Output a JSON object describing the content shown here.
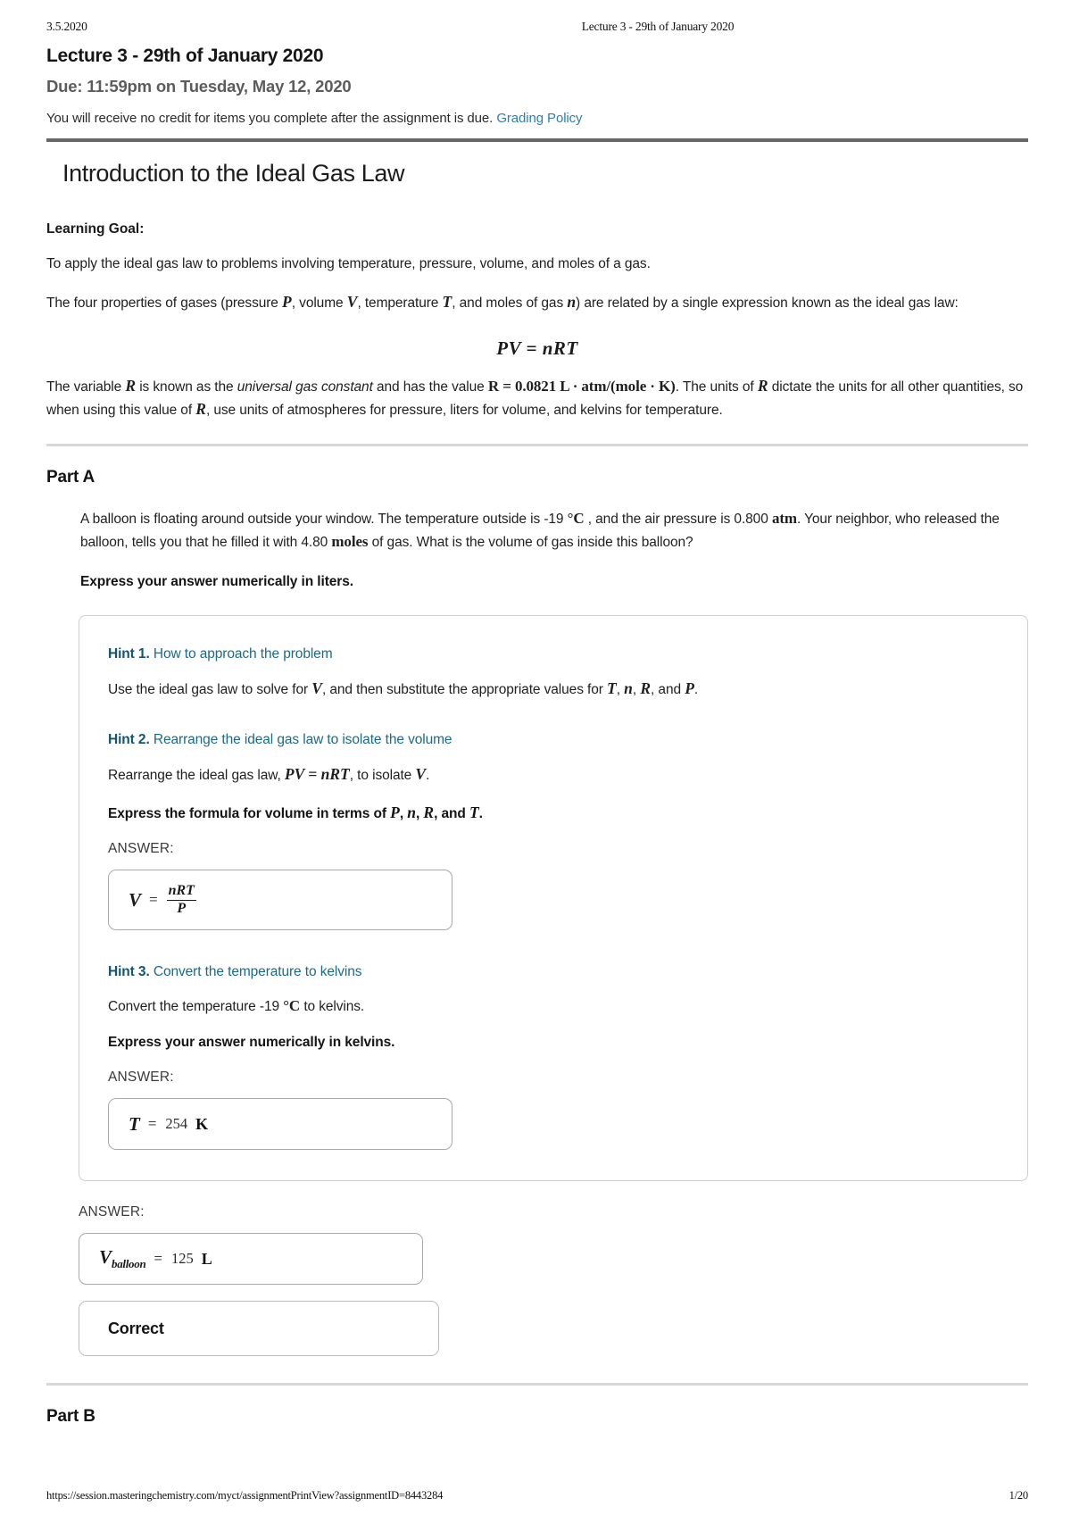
{
  "running_header": {
    "date": "3.5.2020",
    "title": "Lecture 3 - 29th of January 2020"
  },
  "assignment": {
    "title": "Lecture 3 - 29th of January 2020",
    "due": "Due: 11:59pm on Tuesday, May 12, 2020",
    "credit_note": "You will receive no credit for items you complete after the assignment is due.",
    "grading_policy_link": "Grading Policy"
  },
  "item": {
    "title": "Introduction to the Ideal Gas Law",
    "learning_goal_label": "Learning Goal:",
    "learning_goal_text": "To apply the ideal gas law to problems involving temperature, pressure, volume, and moles of a gas.",
    "intro_part1": "The four properties of gases (pressure ",
    "intro_var_P": "P",
    "intro_part2": ", volume ",
    "intro_var_V": "V",
    "intro_part3": ", temperature ",
    "intro_var_T": "T",
    "intro_part4": ", and moles of gas ",
    "intro_var_n": "n",
    "intro_part5": ") are related by a single expression known as the ideal gas law:",
    "display_equation": "PV = nRT",
    "constant_part1": "The variable ",
    "constant_var_R": "R",
    "constant_part2": " is known as the ",
    "constant_italic": "universal gas constant",
    "constant_part3": " and has the value ",
    "constant_value": "R = 0.0821 L · atm/(mole · K)",
    "constant_part4": ". The units of ",
    "constant_var_R2": "R",
    "constant_part5": " dictate the units for all other quantities, so when using this value of ",
    "constant_var_R3": "R",
    "constant_part6": ", use units of atmospheres for pressure, liters for volume, and kelvins for temperature."
  },
  "part_a": {
    "heading": "Part A",
    "question_p1": "A balloon is floating around outside your window. The temperature outside is -19 ",
    "question_unit_c": "°C",
    "question_p2": " , and the air pressure is 0.800 ",
    "question_unit_atm": "atm",
    "question_p3": ". Your neighbor, who released the balloon, tells you that he filled it with 4.80 ",
    "question_unit_moles": "moles",
    "question_p4": " of gas. What is the volume of gas inside this balloon?",
    "instruction": "Express your answer numerically in liters.",
    "answer_label": "ANSWER:",
    "answer_var": "V",
    "answer_sub": "balloon",
    "answer_eq": "=",
    "answer_value": "125",
    "answer_unit": "L",
    "feedback": "Correct"
  },
  "hints": [
    {
      "number": "Hint 1.",
      "title": " How to approach the problem",
      "body_p1": "Use the ideal gas law to solve for ",
      "body_v": "V",
      "body_p2": ", and then substitute the appropriate values for ",
      "body_T": "T",
      "body_sep1": ", ",
      "body_n": "n",
      "body_sep2": ", ",
      "body_R": "R",
      "body_sep3": ", and ",
      "body_P": "P",
      "body_p3": "."
    },
    {
      "number": "Hint 2.",
      "title": " Rearrange the ideal gas law to isolate the volume",
      "body_p1": "Rearrange the ideal gas law, ",
      "body_eq": "PV = nRT",
      "body_p2": ", to isolate ",
      "body_v": "V",
      "body_p3": ".",
      "instruction_p1": "Express the formula for volume in terms of ",
      "instruction_P": "P",
      "instruction_sep1": ", ",
      "instruction_n": "n",
      "instruction_sep2": ", ",
      "instruction_R": "R",
      "instruction_sep3": ", and ",
      "instruction_T": "T",
      "instruction_p2": ".",
      "answer_label": "ANSWER:",
      "answer_var": "V",
      "answer_eq": "=",
      "answer_numerator": "nRT",
      "answer_denominator": "P"
    },
    {
      "number": "Hint 3.",
      "title": " Convert the temperature to kelvins",
      "body_p1": "Convert the temperature -19 ",
      "body_unit": "°C",
      "body_p2": " to kelvins.",
      "instruction": "Express your answer numerically in kelvins.",
      "answer_label": "ANSWER:",
      "answer_var": "T",
      "answer_eq": "=",
      "answer_value": "254",
      "answer_unit": "K"
    }
  ],
  "part_b": {
    "heading": "Part B"
  },
  "footer": {
    "url": "https://session.masteringchemistry.com/myct/assignmentPrintView?assignmentID=8443284",
    "page": "1/20"
  }
}
